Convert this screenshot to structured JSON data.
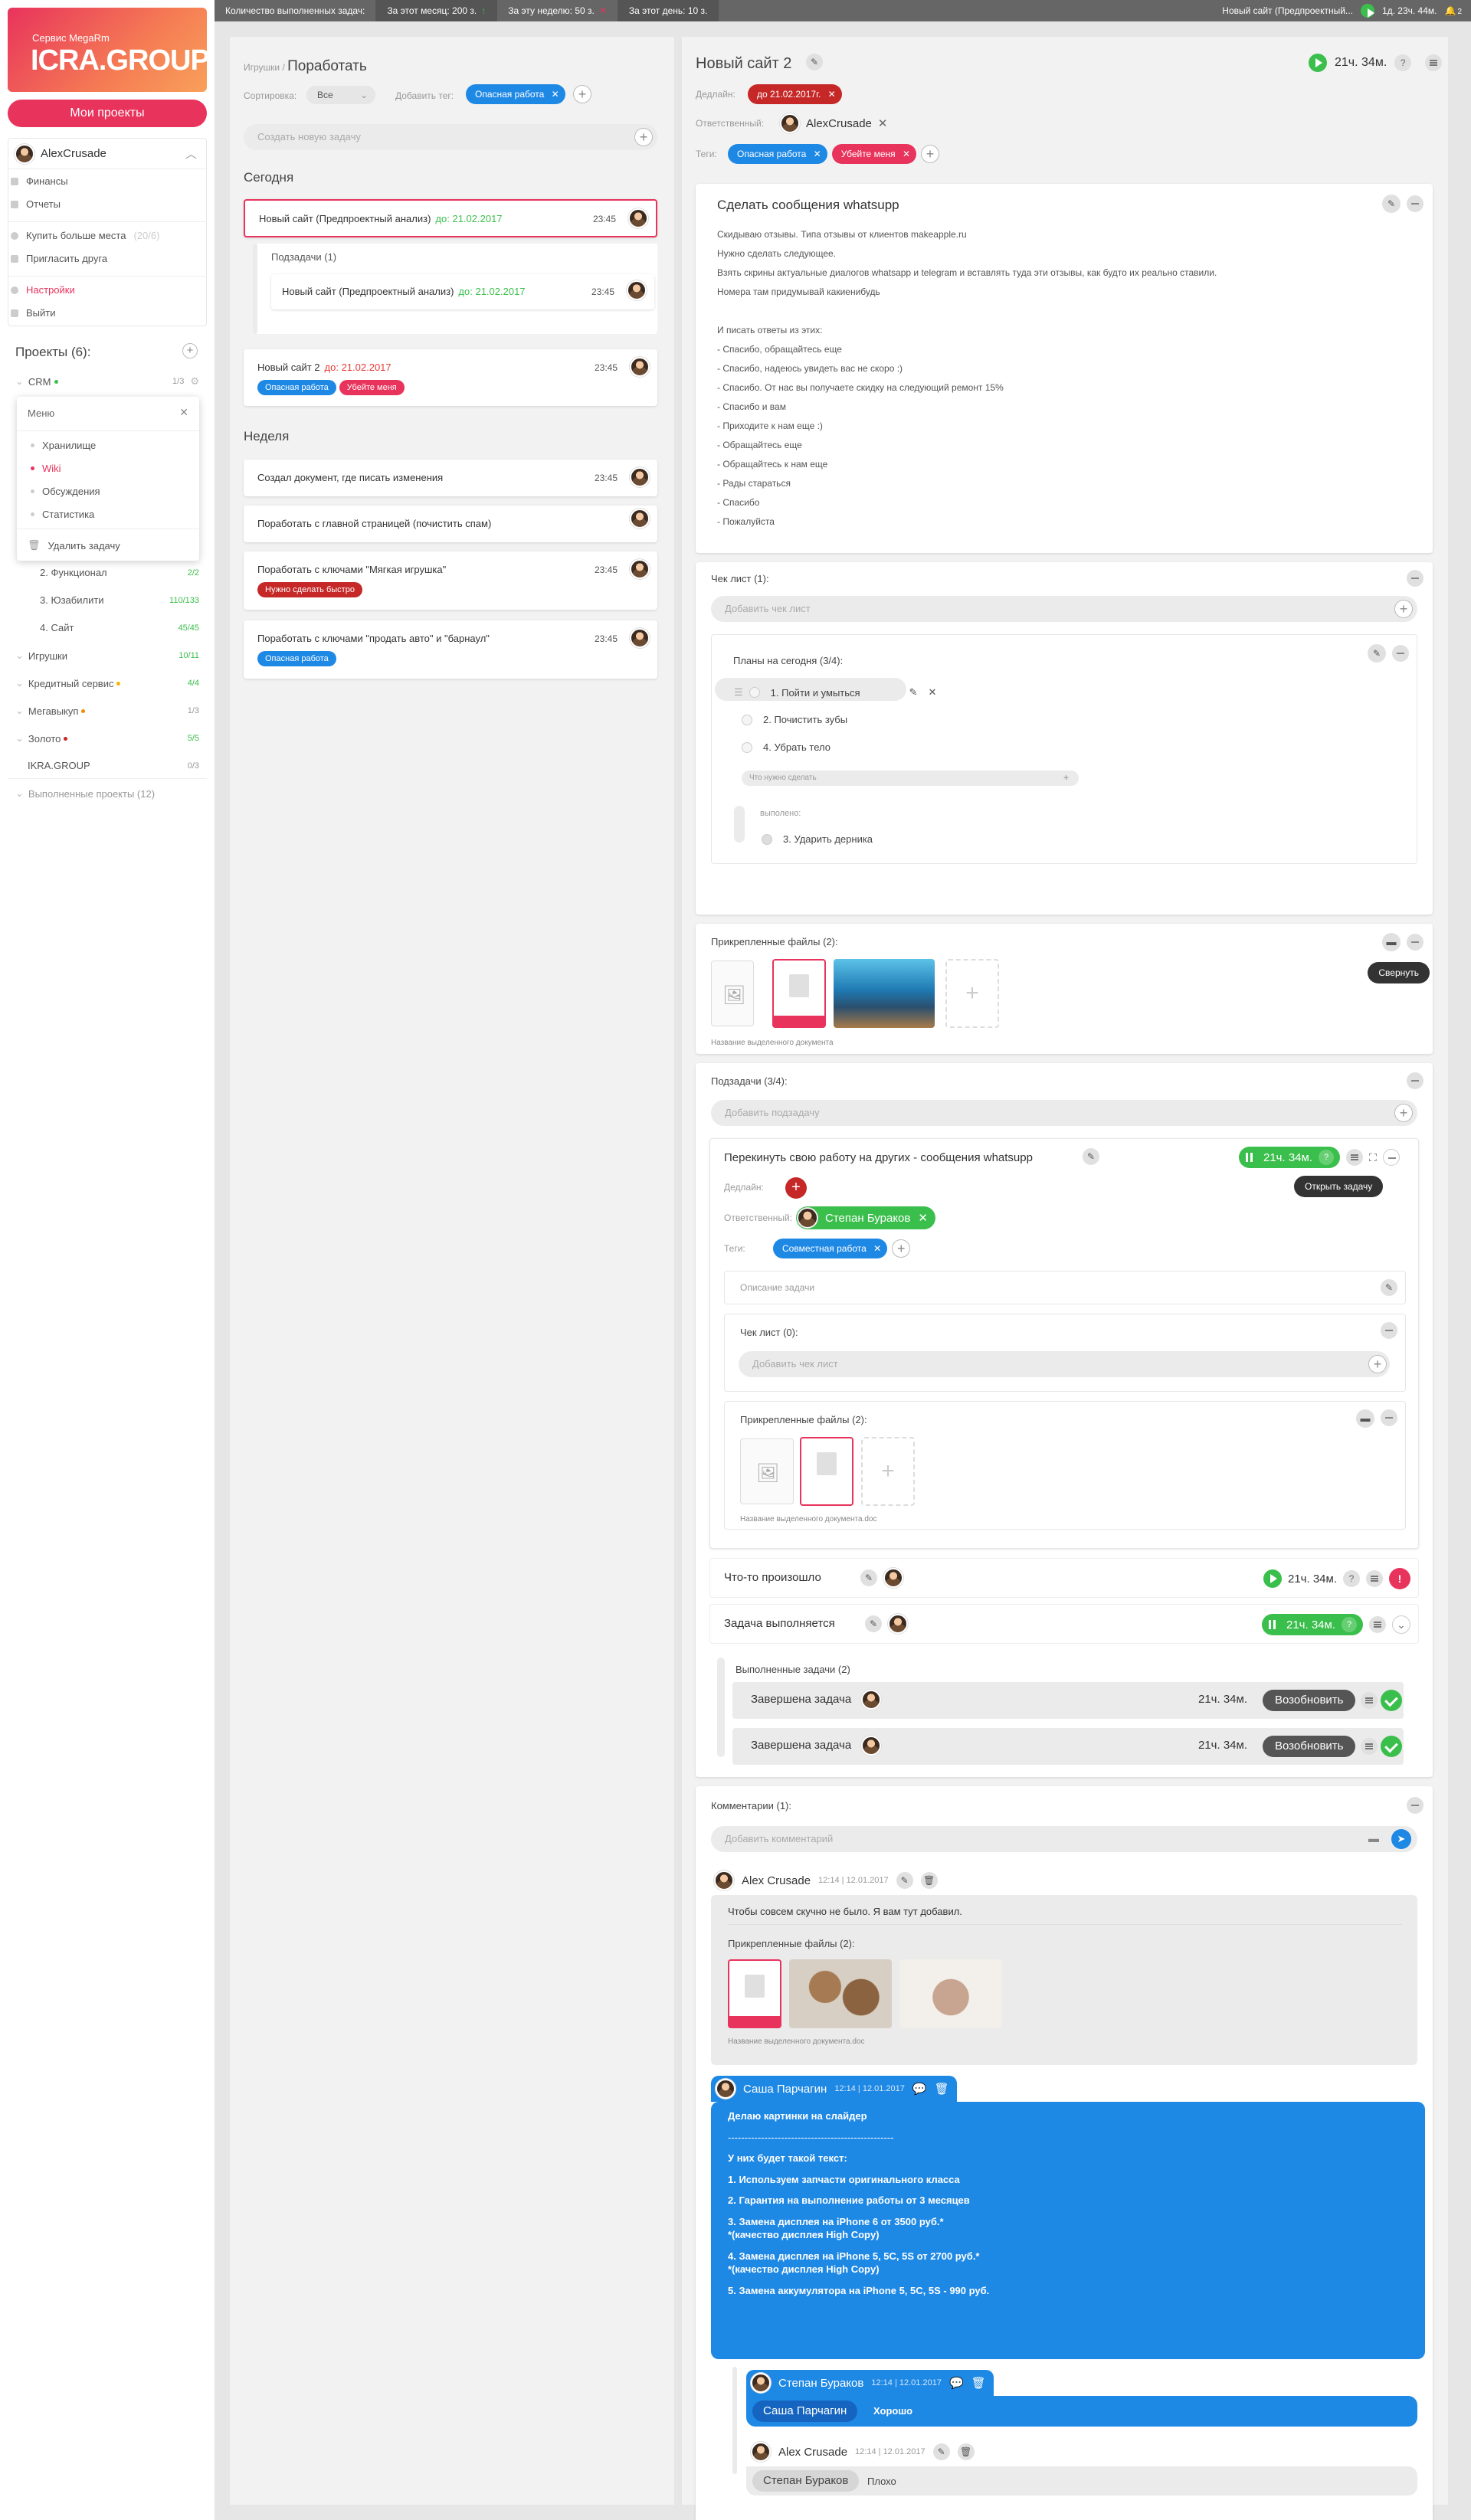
{
  "topbar": {
    "stats_label": "Количество выполненных задач:",
    "month": "За этот месяц: 200 з.",
    "week": "За эту неделю: 50 з.",
    "day": "За этот день: 10 з.",
    "current": "Новый сайт (Предпроектный...",
    "timer": "1д. 23ч. 44м.",
    "notif": "2"
  },
  "sidebar": {
    "logo_small": "Сервис MegaRm",
    "logo_big": "ICRA.GROUP",
    "my_projects": "Мои проекты",
    "user": "AlexCrusade",
    "menu": [
      "Финансы",
      "Отчеты",
      "Купить больше места",
      "Пригласить друга",
      "Настройки",
      "Выйти"
    ],
    "space": "(20/6)",
    "projects_title": "Проекты (6):",
    "crm": {
      "name": "CRM",
      "count": "1/3"
    },
    "dropdown": {
      "title": "Меню",
      "items": [
        "Хранилище",
        "Wiki",
        "Обсуждения",
        "Статистика"
      ],
      "delete": "Удалить задачу"
    },
    "subprojects": [
      {
        "name": "2. Функционал",
        "count": "2/2"
      },
      {
        "name": "3. Юзабилити",
        "count": "110/133"
      },
      {
        "name": "4. Сайт",
        "count": "45/45"
      }
    ],
    "projects": [
      {
        "name": "Игрушки",
        "count": "10/11"
      },
      {
        "name": "Кредитный сервис",
        "count": "4/4"
      },
      {
        "name": "Мегавыкуп",
        "count": "1/3"
      },
      {
        "name": "Золото",
        "count": "5/5"
      },
      {
        "name": "IKRA.GROUP",
        "count": "0/3"
      }
    ],
    "completed": "Выполненные проекты (12)"
  },
  "middle": {
    "crumb": "Игрушки /",
    "title": "Поработать",
    "sort_label": "Сортировка:",
    "sort_value": "Все",
    "addtag_label": "Добавить тег:",
    "tag": "Опасная работа",
    "new_task": "Создать новую задачу",
    "today": "Сегодня",
    "week": "Неделя",
    "task1": {
      "title": "Новый сайт (Предпроектный анализ)",
      "due": "до: 21.02.2017",
      "time": "23:45"
    },
    "subtasks": "Подзадачи (1)",
    "task1sub": {
      "title": "Новый сайт (Предпроектный анализ)",
      "due": "до: 21.02.2017",
      "time": "23:45"
    },
    "task2": {
      "title": "Новый сайт 2",
      "due": "до: 21.02.2017",
      "time": "23:45",
      "tags": [
        "Опасная работа",
        "Убейте меня"
      ]
    },
    "week_tasks": [
      {
        "title": "Создал документ, где писать изменения",
        "time": "23:45"
      },
      {
        "title": "Поработать с главной страницей (почистить спам)",
        "time": ""
      },
      {
        "title": "Поработать с ключами \"Мягкая игрушка\"",
        "time": "23:45",
        "tag": "Нужно сделать быстро"
      },
      {
        "title": "Поработать с ключами \"продать авто\" и \"барнаул\"",
        "time": "23:45",
        "tag": "Опасная работа"
      }
    ]
  },
  "right": {
    "title": "Новый сайт 2",
    "timer": "21ч. 34м.",
    "deadline_label": "Дедлайн:",
    "deadline": "до 21.02.2017г.",
    "resp_label": "Ответственный:",
    "resp": "AlexCrusade",
    "tags_label": "Теги:",
    "tags": [
      "Опасная работа",
      "Убейте меня"
    ],
    "desc_title": "Сделать сообщения whatsupp",
    "desc": [
      "Скидываю отзывы. Типа отзывы от клиентов makeapple.ru",
      "Нужно сделать следующее.",
      "Взять скрины актуальные диалогов whatsapp и telegram и вставлять туда эти отзывы, как будто их реально ставили.",
      "Номера там придумывай какиенибудь",
      "",
      "И писать ответы из этих:",
      "- Спасибо, обращайтесь еще",
      "- Спасибо, надеюсь увидеть вас не скоро :)",
      "- Спасибо. От нас вы получаете скидку на следующий ремонт 15%",
      "- Спасибо и вам",
      "- Приходите к нам еще :)",
      "- Обращайтесь еще",
      "- Обращайтесь к нам еще",
      "- Рады стараться",
      "- Спасибо",
      "- Пожалуйста"
    ],
    "checklist_title": "Чек лист (1):",
    "add_checklist": "Добавить чек лист",
    "plans": "Планы на сегодня (3/4):",
    "check_items": [
      "1. Пойти и умыться",
      "2. Почистить зубы",
      "4. Убрать тело"
    ],
    "what_todo": "Что нужно сделать",
    "done_label": "выполено:",
    "done_item": "3. Ударить дерника",
    "files_title": "Прикрепленные файлы (2):",
    "collapse": "Свернуть",
    "file_caption": "Название выделенного документа",
    "subtasks_title": "Подзадачи (3/4):",
    "add_subtask": "Добавить подзадачу",
    "sub1": {
      "title": "Перекинуть свою работу на других - сообщения whatsupp",
      "timer": "21ч. 34м.",
      "open_tip": "Открыть задачу",
      "deadline_label": "Дедлайн:",
      "resp_label": "Ответственный:",
      "resp": "Степан Бураков",
      "tags_label": "Теги:",
      "tag": "Совместная работа",
      "desc_ph": "Описание задачи",
      "checklist": "Чек лист (0):",
      "add_checklist": "Добавить чек лист",
      "files": "Прикрепленные файлы (2):",
      "caption": "Название выделенного документа.doc"
    },
    "sub2": {
      "title": "Что-то произошло",
      "timer": "21ч. 34м."
    },
    "sub3": {
      "title": "Задача выполняется",
      "timer": "21ч. 34м."
    },
    "done_title": "Выполненные задачи (2)",
    "done_rows": [
      {
        "title": "Завершена задача",
        "timer": "21ч. 34м.",
        "btn": "Возобновить"
      },
      {
        "title": "Завершена задача",
        "timer": "21ч. 34м.",
        "btn": "Возобновить"
      }
    ],
    "comments_title": "Комментарии (1):",
    "add_comment": "Добавить комментарий",
    "c1": {
      "author": "Alex Crusade",
      "time": "12:14",
      "date": "12.01.2017",
      "text": "Чтобы совсем скучно не было. Я вам тут добавил.",
      "files": "Прикрепленные файлы (2):",
      "caption": "Название выделенного документа.doc"
    },
    "c2": {
      "author": "Саша Парчагин",
      "time": "12:14",
      "date": "12.01.2017",
      "lines": [
        "Делаю картинки на слайдер",
        "--------------------------------------------------",
        "У них будет такой текст:",
        "1. Используем запчасти оригинального класса",
        "2. Гарантия на выполнение работы от 3 месяцев",
        "3. Замена дисплея на iPhone 6 от 3500 руб.*",
        "*(качество дисплея High Copy)",
        "4. Замена дисплея на iPhone 5, 5C, 5S от 2700 руб.*",
        "*(качество дисплея High Copy)",
        "5. Замена аккумулятора на iPhone 5, 5C, 5S - 990 руб."
      ]
    },
    "c3": {
      "author": "Степан Бураков",
      "time": "12:14",
      "date": "12.01.2017",
      "quote_name": "Саша Парчагин",
      "quote_text": "Хорошо"
    },
    "c4": {
      "author": "Alex Crusade",
      "time": "12:14",
      "date": "12.01.2017",
      "quote_name": "Степан Бураков",
      "quote_text": "Плохо"
    }
  },
  "colors": {
    "accent": "#e8335c",
    "blue": "#1e88e5",
    "green": "#3bbf4c",
    "red": "#c62828"
  }
}
